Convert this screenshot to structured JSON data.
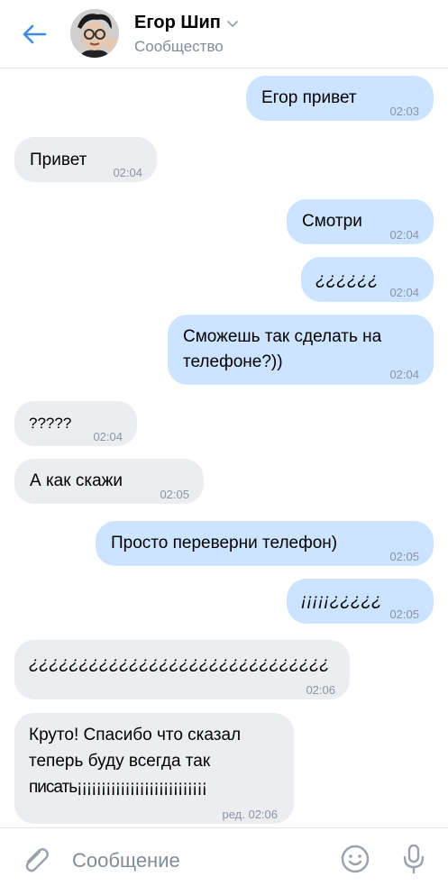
{
  "header": {
    "title": "Егор Шип",
    "subtitle": "Сообщество"
  },
  "messages": [
    {
      "dir": "out",
      "lines": [
        "Егор привет"
      ],
      "time": "02:03"
    },
    {
      "dir": "in",
      "lines": [
        "Привет"
      ],
      "time": "02:04"
    },
    {
      "dir": "out",
      "lines": [
        "Смотри"
      ],
      "time": "02:04"
    },
    {
      "dir": "out",
      "lines": [
        "¿¿¿¿¿¿"
      ],
      "time": "02:04"
    },
    {
      "dir": "out",
      "lines": [
        "Сможешь так сделать на",
        "телефоне?))"
      ],
      "time": "02:04"
    },
    {
      "dir": "in",
      "lines": [
        "?????"
      ],
      "time": "02:04"
    },
    {
      "dir": "in",
      "lines": [
        "А как скажи"
      ],
      "time": "02:05"
    },
    {
      "dir": "out",
      "lines": [
        "Просто переверни телефон)"
      ],
      "time": "02:05"
    },
    {
      "dir": "out",
      "lines": [
        "¡¡¡¡¡¿¿¿¿¿"
      ],
      "time": "02:05"
    },
    {
      "dir": "in",
      "lines": [
        "¿¿¿¿¿¿¿¿¿¿¿¿¿¿¿¿¿¿¿¿¿¿¿¿¿¿¿¿¿¿"
      ],
      "time": "02:06"
    },
    {
      "dir": "in",
      "lines": [
        "Круто! Спасибо что сказал",
        "теперь буду всегда так",
        "писать¡¡¡¡¡¡¡¡¡¡¡¡¡¡¡¡¡¡¡¡¡¡¡¡¡¡¡"
      ],
      "time": "ред. 02:06"
    }
  ],
  "composer": {
    "placeholder": "Сообщение"
  },
  "colors": {
    "accent": "#3f8ae0",
    "outgoing_bubble": "#cce4ff",
    "incoming_bubble": "#ebedf0",
    "secondary_text": "#818c99"
  },
  "icons": {
    "back": "arrow-left-icon",
    "attach": "paperclip-icon",
    "emoji": "smile-icon",
    "voice": "microphone-icon",
    "dropdown": "chevron-down-icon"
  }
}
